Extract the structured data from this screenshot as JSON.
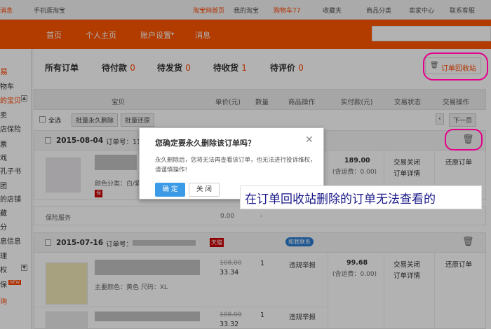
{
  "topbar": {
    "msg": "消息",
    "mobile": "手机逛淘宝",
    "home": "淘宝网首页",
    "mytaobao": "我的淘宝",
    "cart": "购物车77",
    "fav": "收藏夹",
    "category": "商品分类",
    "seller": "卖家中心",
    "service": "联系客服"
  },
  "nav": {
    "items": [
      "首页",
      "个人主页",
      "账户设置",
      "消息"
    ]
  },
  "sidebar": {
    "items": [
      "易",
      "物车",
      "的宝贝",
      "卖",
      "店保险",
      "票",
      "戏",
      "孔子书",
      "团",
      "的店铺",
      "藏",
      "分",
      "息信息",
      "理",
      "权",
      "保",
      "询"
    ],
    "new_badge": "NEW"
  },
  "tabs": [
    {
      "label": "所有订单",
      "count": ""
    },
    {
      "label": "待付款",
      "count": "0"
    },
    {
      "label": "待发货",
      "count": "0"
    },
    {
      "label": "待收货",
      "count": "1"
    },
    {
      "label": "待评价",
      "count": "0"
    }
  ],
  "recycle_label": "订单回收站",
  "table_headers": [
    "宝贝",
    "单价(元)",
    "数量",
    "商品操作",
    "实付款(元)",
    "交易状态",
    "交易操作"
  ],
  "batch": {
    "select_all": "全选",
    "batch_delete": "批量永久删除",
    "batch_restore": "批量还原",
    "next_page": "下一页"
  },
  "order1": {
    "date": "2015-08-04",
    "order_no_label": "订单号：118",
    "color": "颜色分类：白/紫",
    "total": "189.00",
    "shipping": "(含运费：0.00)",
    "status": "交易关闭",
    "detail": "订单详情",
    "action": "还原订单",
    "service": "保险服务",
    "service_price": "0.00",
    "service_qty": "-"
  },
  "order2": {
    "date": "2015-07-16",
    "order_no_label": "订单号：",
    "shop_tag": "天猫",
    "contact": "和我联系",
    "old_price": "108.00",
    "price": "33.34",
    "qty": "1",
    "item_op": "违规举报",
    "total": "99.68",
    "shipping": "(含运费：0.00)",
    "status": "交易关闭",
    "detail": "订单详情",
    "action": "还原订单",
    "attrs": "主要颜色：黄色  尺码：XL",
    "old_price2": "108.00",
    "price2": "33.32",
    "qty2": "1",
    "item_op2": "违规举报"
  },
  "modal": {
    "title": "您确定要永久删除该订单吗？",
    "message": "永久删除后，您将无法再查看该订单，也无法进行投诉维权，请谨慎操作!",
    "confirm": "确 定",
    "cancel": "关 闭"
  },
  "annotation": "在订单回收站删除的订单无法查看的"
}
